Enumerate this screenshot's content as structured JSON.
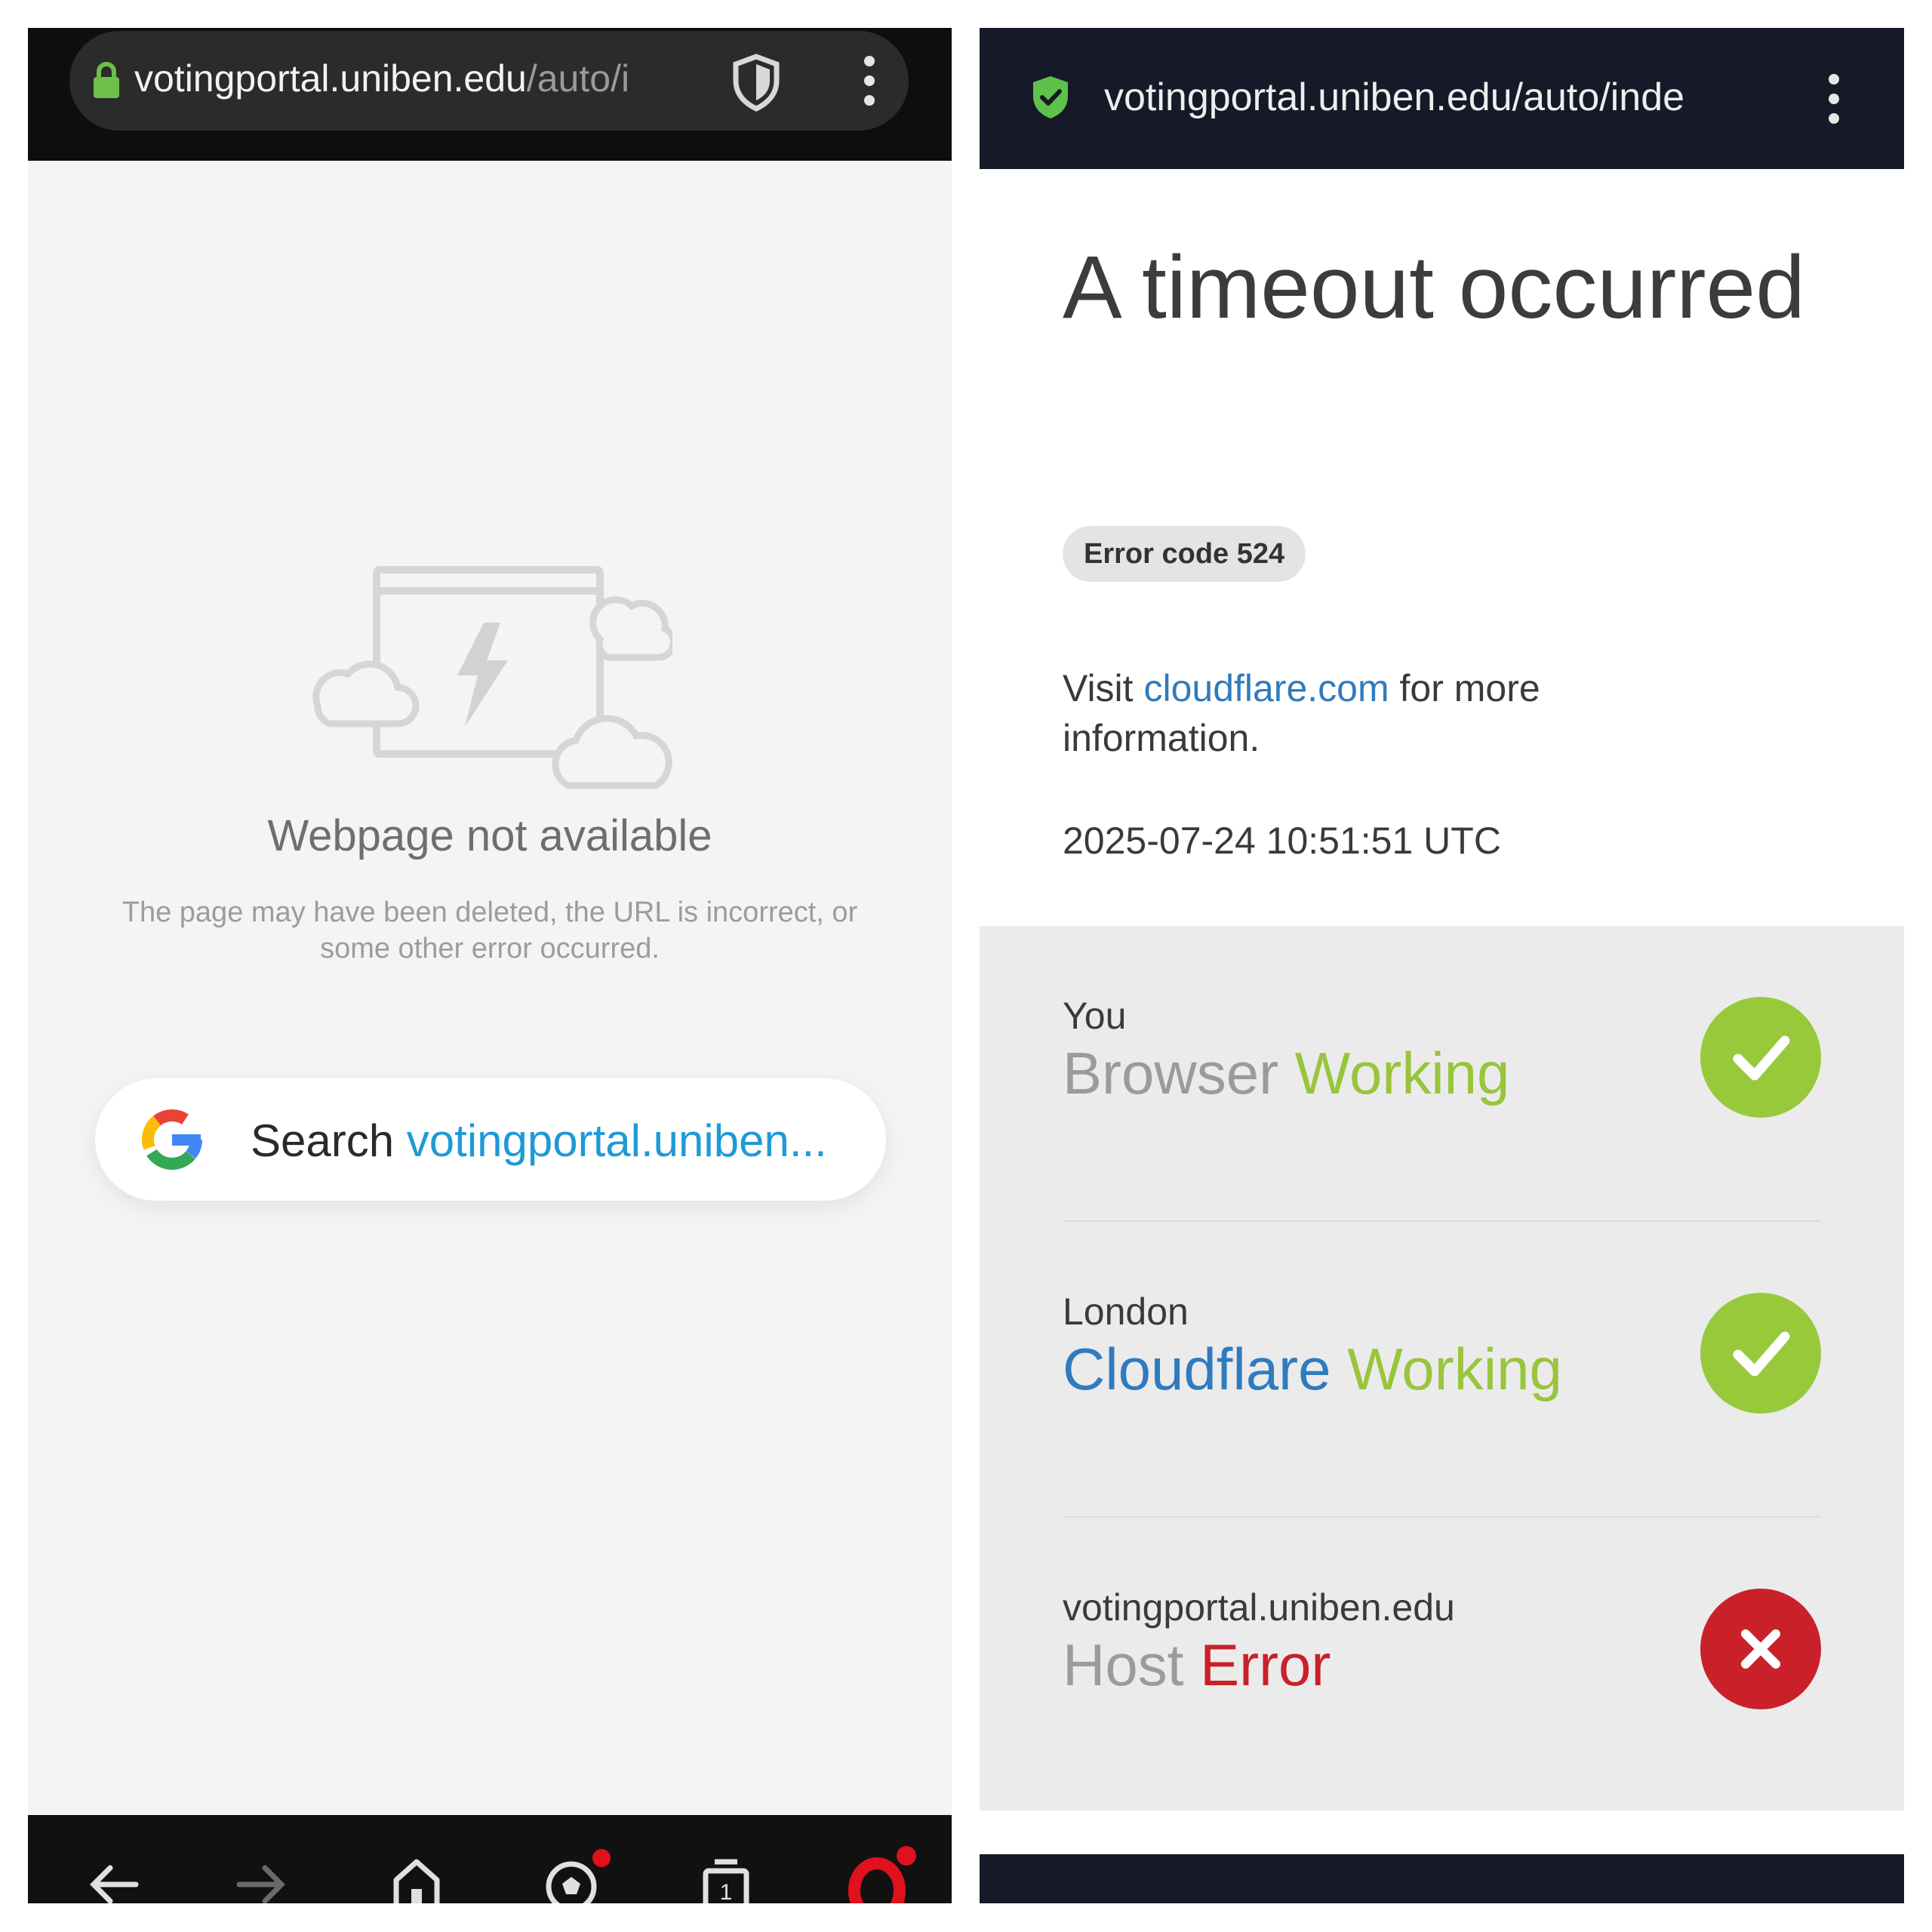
{
  "left_panel": {
    "url_host": "votingportal.uniben.edu",
    "url_path": "/auto/i",
    "error_title": "Webpage not available",
    "error_description": "The page may have been deleted, the URL is incorrect, or some other error occurred.",
    "search_label": "Search",
    "search_url": "votingportal.uniben...",
    "bottom_nav": {
      "tab_count": "1",
      "icons": [
        "back-arrow-icon",
        "forward-arrow-icon",
        "home-icon",
        "football-icon",
        "tabs-icon",
        "opera-menu-icon"
      ]
    },
    "colors": {
      "lock": "#6cc04a",
      "search_link": "#1e9ad6",
      "badge": "#e0101c"
    }
  },
  "right_panel": {
    "url": "votingportal.uniben.edu/auto/inde",
    "heading": "A timeout occurred",
    "error_code": "Error code 524",
    "visit_prefix": "Visit",
    "visit_link": "cloudflare.com",
    "visit_suffix": "for more information.",
    "timestamp": "2025-07-24 10:51:51 UTC",
    "status_rows": [
      {
        "location": "You",
        "name": "Browser",
        "status": "Working",
        "state": "ok"
      },
      {
        "location": "London",
        "name": "Cloudflare",
        "status": "Working",
        "state": "ok"
      },
      {
        "location": "votingportal.uniben.edu",
        "name": "Host",
        "status": "Error",
        "state": "error"
      }
    ],
    "colors": {
      "working": "#98c53c",
      "error": "#c9202a",
      "link": "#2f7bbf",
      "shield": "#5ec24a"
    }
  }
}
